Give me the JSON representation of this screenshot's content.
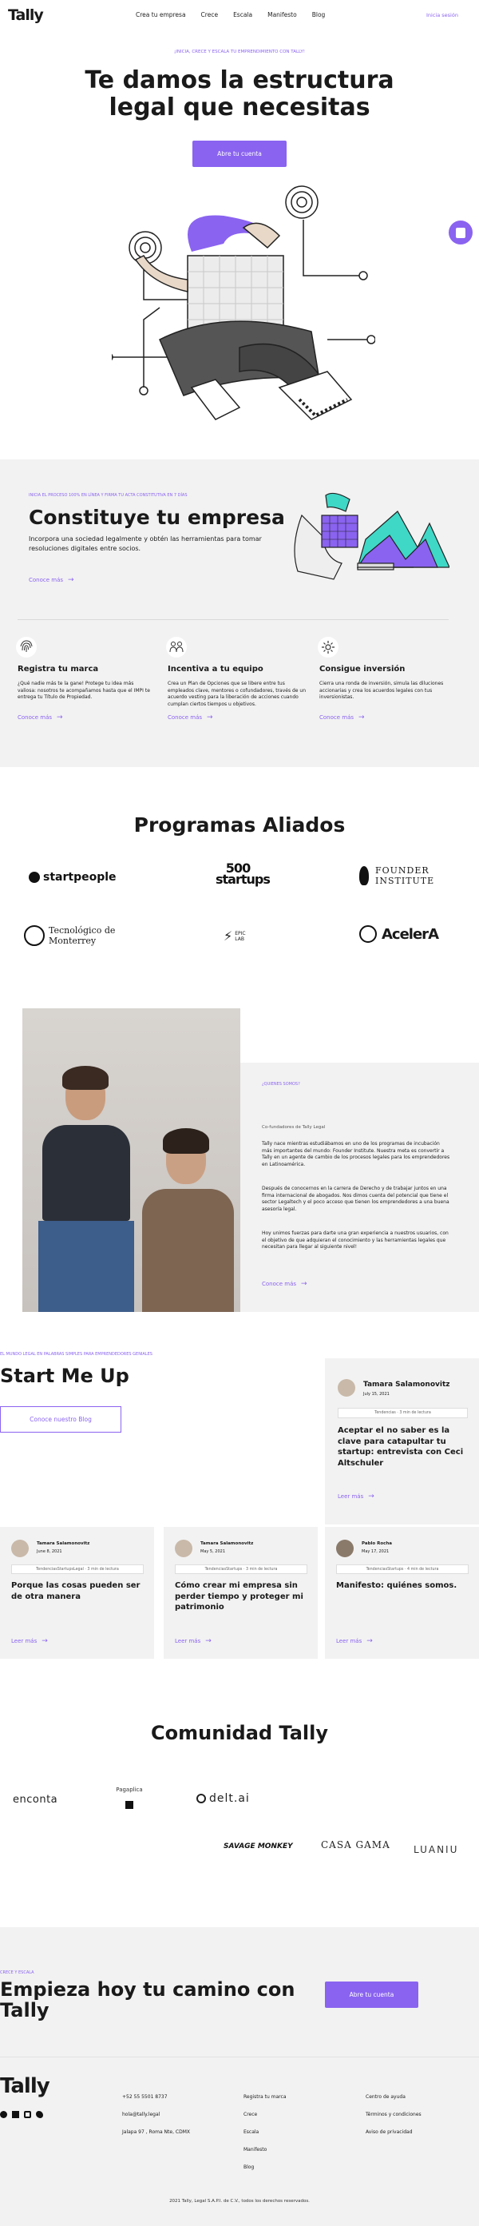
{
  "header": {
    "logo": "Tally",
    "nav": [
      "Crea tu empresa",
      "Crece",
      "Escala",
      "Manifesto",
      "Blog"
    ],
    "login": "Inicia sesión"
  },
  "hero": {
    "eyebrow": "¡INICIA, CRECE Y ESCALA TU EMPRENDIMIENTO CON TALLY!",
    "title_line1": "Te damos la estructura",
    "title_line2": "legal que necesitas",
    "cta": "Abre tu cuenta"
  },
  "constituye": {
    "eyebrow": "INICIA EL PROCESO 100% EN LÍNEA Y FIRMA TU ACTA CONSTITUTIVA EN 7 DÍAS",
    "title": "Constituye tu empresa",
    "body": "Incorpora una sociedad legalmente y obtén las herramientas para tomar resoluciones digitales entre socios.",
    "link": "Conoce más"
  },
  "features": [
    {
      "icon": "fingerprint-icon",
      "title": "Registra tu marca",
      "body": "¿Qué nadie más te la gane! Protege tu idea más valiosa: nosotros te acompañamos hasta que el IMPI te entrega tu Título de Propiedad.",
      "link": "Conoce más"
    },
    {
      "icon": "people-icon",
      "title": "Incentiva a tu equipo",
      "body": "Crea un Plan de Opciones que se libere entre tus empleados clave, mentores o cofundadores, través de un acuerdo vesting para la liberación de acciones cuando cumplan ciertos tiempos u objetivos.",
      "link": "Conoce más"
    },
    {
      "icon": "gear-icon",
      "title": "Consigue inversión",
      "body": "Cierra una ronda de inversión, simula las diluciones accionarias y crea los acuerdos legales con tus inversionistas.",
      "link": "Conoce más"
    }
  ],
  "programs": {
    "title": "Programas Aliados",
    "logos": [
      "startpeople",
      "500 startups",
      "FOUNDER INSTITUTE",
      "Tecnológico de Monterrey",
      "EPIC LAB",
      "AcelerA"
    ]
  },
  "about": {
    "eyebrow": "¿QUIENES SOMOS?",
    "sub": "Co-fundadores de Tally Legal",
    "p1": "Tally nace mientras estudiábamos en uno de los programas de incubación más importantes del mundo: Founder Institute. Nuestra meta es convertir a Tally en un agente de cambio de los procesos legales para los emprendedores en Latinoamérica.",
    "p2": "Después de conocernos en la carrera de Derecho y de trabajar juntos en una firma internacional de abogados. Nos dimos cuenta del potencial que tiene el sector Legaltech y el poco acceso que tienen los emprendedores a una buena asesoría legal.",
    "p3": "Hoy unimos fuerzas para darte una gran experiencia a nuestros usuarios, con el objetivo de que adquieran el conocimiento y las herramientas legales que necesitan para llegar al siguiente nivel!",
    "link": "Conoce más"
  },
  "blog": {
    "eyebrow": "EL MUNDO LEGAL EN PALABRAS SIMPLES PARA EMPRENDEDORES GENIALES",
    "title": "Start Me Up",
    "button": "Conoce nuestro Blog",
    "featured": {
      "author": "Tamara Salamonovitz",
      "date": "July 15, 2021",
      "tag": "Tendencias   ·   3 min de lectura",
      "title": "Aceptar el no saber es la clave para catapultar tu startup: entrevista con Ceci Altschuler",
      "link": "Leer más"
    },
    "posts": [
      {
        "author": "Tamara Salamonovitz",
        "date": "June 8, 2021",
        "tag": "TendenciasStartupsLegal   ·   3 min de lectura",
        "title": "Porque las cosas pueden ser de otra manera",
        "link": "Leer más"
      },
      {
        "author": "Tamara Salamonovitz",
        "date": "May 5, 2021",
        "tag": "TendenciasStartups   ·   3 min de lectura",
        "title": "Cómo crear mi empresa sin perder tiempo y proteger mi patrimonio",
        "link": "Leer más"
      },
      {
        "author": "Pablo Rocha",
        "date": "May 17, 2021",
        "tag": "TendenciasStartups   ·   4 min de lectura",
        "title": "Manifesto: quiénes somos.",
        "link": "Leer más"
      }
    ]
  },
  "community": {
    "title": "Comunidad Tally",
    "logos": [
      "enconta",
      "Pagaplica",
      "delt.ai",
      "SAVAGE MONKEY",
      "CASA GAMA",
      "LUANIU"
    ]
  },
  "cta": {
    "eyebrow": "CRECE Y ESCALA",
    "title_line1": "Empieza hoy tu camino con",
    "title_line2": "Tally",
    "button": "Abre tu cuenta"
  },
  "footer": {
    "logo": "Tally",
    "col1": [
      "+52 55 5501 8737",
      "hola@tally.legal",
      "Jalapa 97 , Roma Nte, CDMX"
    ],
    "col2": [
      "Registra tu marca",
      "Crece",
      "Escala",
      "Manifesto",
      "Blog"
    ],
    "col3": [
      "Centro de ayuda",
      "Términos y condiciones",
      "Aviso de privacidad"
    ],
    "copyright": "2021 Tally, Legal S.A.P.I. de C.V., todos los derechos reservados."
  },
  "colors": {
    "accent": "#8a63f0",
    "gray": "#f2f2f2"
  }
}
